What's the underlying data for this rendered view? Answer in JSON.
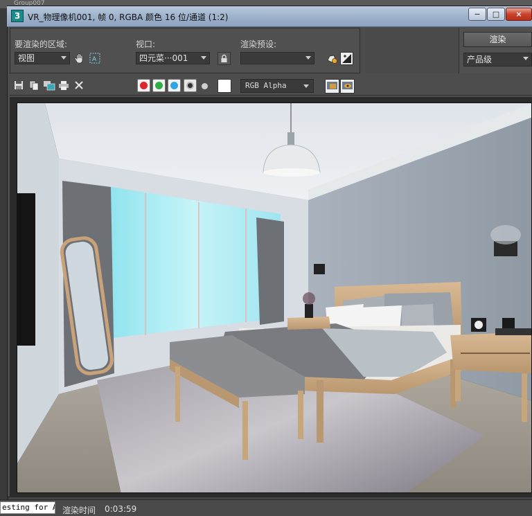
{
  "background_app": {
    "item_label": "Group007"
  },
  "window": {
    "app_icon": "3",
    "title": "VR_物理像机001, 帧 0, RGBA 颜色 16 位/通道 (1:2)",
    "buttons": {
      "minimize": "−",
      "maximize": "□",
      "close": "×"
    }
  },
  "controls": {
    "area_label": "要渲染的区域:",
    "area_value": "视图",
    "viewport_label": "视口:",
    "viewport_value": "四元菜···001",
    "preset_label": "渲染预设:",
    "preset_value": "",
    "render_button": "渲染",
    "quality_value": "产品级"
  },
  "toolbar": {
    "icons": [
      "save-icon",
      "copy-icon",
      "clone-icon",
      "print-icon",
      "clear-icon"
    ],
    "channel_colors": {
      "red": "#e0242e",
      "green": "#2fae45",
      "blue": "#2fa7e6"
    },
    "channel_select": "RGB Alpha"
  },
  "status": {
    "input_text": "esting for ALl",
    "time_label": "渲染时间",
    "time_value": "0:03:59"
  }
}
